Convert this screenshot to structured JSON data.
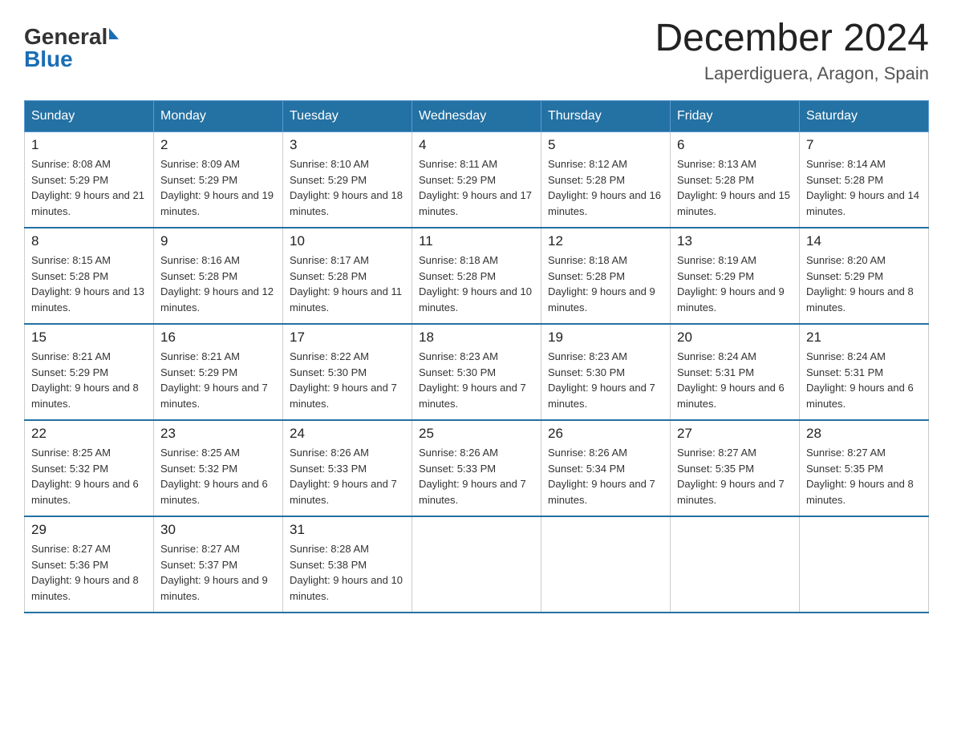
{
  "logo": {
    "text_general": "General",
    "text_blue": "Blue",
    "triangle": true
  },
  "header": {
    "title": "December 2024",
    "subtitle": "Laperdiguera, Aragon, Spain"
  },
  "days_of_week": [
    "Sunday",
    "Monday",
    "Tuesday",
    "Wednesday",
    "Thursday",
    "Friday",
    "Saturday"
  ],
  "weeks": [
    [
      {
        "day": "1",
        "sunrise": "8:08 AM",
        "sunset": "5:29 PM",
        "daylight": "9 hours and 21 minutes."
      },
      {
        "day": "2",
        "sunrise": "8:09 AM",
        "sunset": "5:29 PM",
        "daylight": "9 hours and 19 minutes."
      },
      {
        "day": "3",
        "sunrise": "8:10 AM",
        "sunset": "5:29 PM",
        "daylight": "9 hours and 18 minutes."
      },
      {
        "day": "4",
        "sunrise": "8:11 AM",
        "sunset": "5:29 PM",
        "daylight": "9 hours and 17 minutes."
      },
      {
        "day": "5",
        "sunrise": "8:12 AM",
        "sunset": "5:28 PM",
        "daylight": "9 hours and 16 minutes."
      },
      {
        "day": "6",
        "sunrise": "8:13 AM",
        "sunset": "5:28 PM",
        "daylight": "9 hours and 15 minutes."
      },
      {
        "day": "7",
        "sunrise": "8:14 AM",
        "sunset": "5:28 PM",
        "daylight": "9 hours and 14 minutes."
      }
    ],
    [
      {
        "day": "8",
        "sunrise": "8:15 AM",
        "sunset": "5:28 PM",
        "daylight": "9 hours and 13 minutes."
      },
      {
        "day": "9",
        "sunrise": "8:16 AM",
        "sunset": "5:28 PM",
        "daylight": "9 hours and 12 minutes."
      },
      {
        "day": "10",
        "sunrise": "8:17 AM",
        "sunset": "5:28 PM",
        "daylight": "9 hours and 11 minutes."
      },
      {
        "day": "11",
        "sunrise": "8:18 AM",
        "sunset": "5:28 PM",
        "daylight": "9 hours and 10 minutes."
      },
      {
        "day": "12",
        "sunrise": "8:18 AM",
        "sunset": "5:28 PM",
        "daylight": "9 hours and 9 minutes."
      },
      {
        "day": "13",
        "sunrise": "8:19 AM",
        "sunset": "5:29 PM",
        "daylight": "9 hours and 9 minutes."
      },
      {
        "day": "14",
        "sunrise": "8:20 AM",
        "sunset": "5:29 PM",
        "daylight": "9 hours and 8 minutes."
      }
    ],
    [
      {
        "day": "15",
        "sunrise": "8:21 AM",
        "sunset": "5:29 PM",
        "daylight": "9 hours and 8 minutes."
      },
      {
        "day": "16",
        "sunrise": "8:21 AM",
        "sunset": "5:29 PM",
        "daylight": "9 hours and 7 minutes."
      },
      {
        "day": "17",
        "sunrise": "8:22 AM",
        "sunset": "5:30 PM",
        "daylight": "9 hours and 7 minutes."
      },
      {
        "day": "18",
        "sunrise": "8:23 AM",
        "sunset": "5:30 PM",
        "daylight": "9 hours and 7 minutes."
      },
      {
        "day": "19",
        "sunrise": "8:23 AM",
        "sunset": "5:30 PM",
        "daylight": "9 hours and 7 minutes."
      },
      {
        "day": "20",
        "sunrise": "8:24 AM",
        "sunset": "5:31 PM",
        "daylight": "9 hours and 6 minutes."
      },
      {
        "day": "21",
        "sunrise": "8:24 AM",
        "sunset": "5:31 PM",
        "daylight": "9 hours and 6 minutes."
      }
    ],
    [
      {
        "day": "22",
        "sunrise": "8:25 AM",
        "sunset": "5:32 PM",
        "daylight": "9 hours and 6 minutes."
      },
      {
        "day": "23",
        "sunrise": "8:25 AM",
        "sunset": "5:32 PM",
        "daylight": "9 hours and 6 minutes."
      },
      {
        "day": "24",
        "sunrise": "8:26 AM",
        "sunset": "5:33 PM",
        "daylight": "9 hours and 7 minutes."
      },
      {
        "day": "25",
        "sunrise": "8:26 AM",
        "sunset": "5:33 PM",
        "daylight": "9 hours and 7 minutes."
      },
      {
        "day": "26",
        "sunrise": "8:26 AM",
        "sunset": "5:34 PM",
        "daylight": "9 hours and 7 minutes."
      },
      {
        "day": "27",
        "sunrise": "8:27 AM",
        "sunset": "5:35 PM",
        "daylight": "9 hours and 7 minutes."
      },
      {
        "day": "28",
        "sunrise": "8:27 AM",
        "sunset": "5:35 PM",
        "daylight": "9 hours and 8 minutes."
      }
    ],
    [
      {
        "day": "29",
        "sunrise": "8:27 AM",
        "sunset": "5:36 PM",
        "daylight": "9 hours and 8 minutes."
      },
      {
        "day": "30",
        "sunrise": "8:27 AM",
        "sunset": "5:37 PM",
        "daylight": "9 hours and 9 minutes."
      },
      {
        "day": "31",
        "sunrise": "8:28 AM",
        "sunset": "5:38 PM",
        "daylight": "9 hours and 10 minutes."
      },
      null,
      null,
      null,
      null
    ]
  ]
}
